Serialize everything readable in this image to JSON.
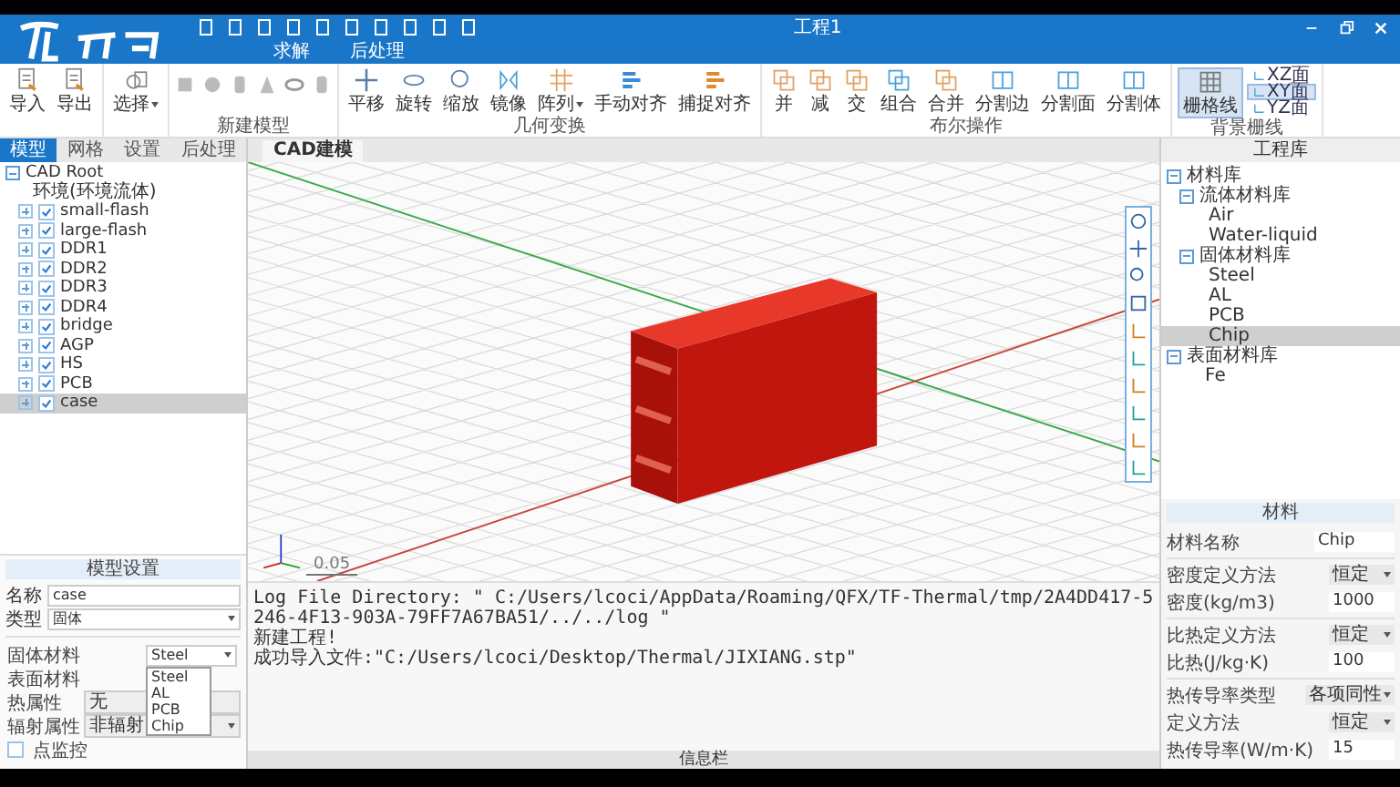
{
  "window": {
    "title": "工程1"
  },
  "ribbon_tabs": [
    "求解",
    "后处理"
  ],
  "ribbon": {
    "file_buttons": [
      "导入",
      "导出"
    ],
    "select_button": {
      "label": "选择",
      "dropdown": true
    },
    "new_model_label": "新建模型",
    "transform": {
      "label": "几何变换",
      "buttons": [
        {
          "label": "平移",
          "dropdown": false
        },
        {
          "label": "旋转",
          "dropdown": false
        },
        {
          "label": "缩放",
          "dropdown": false
        },
        {
          "label": "镜像",
          "dropdown": false
        },
        {
          "label": "阵列",
          "dropdown": true
        },
        {
          "label": "手动对齐",
          "dropdown": false
        },
        {
          "label": "捕捉对齐",
          "dropdown": false
        }
      ]
    },
    "boolean": {
      "label": "布尔操作",
      "buttons": [
        "并",
        "减",
        "交",
        "组合",
        "合并",
        "分割边",
        "分割面",
        "分割体"
      ]
    },
    "background_grid": {
      "label": "背景栅线",
      "grid_button": {
        "label": "栅格线",
        "selected": true
      },
      "planes": [
        {
          "label": "XZ面",
          "selected": false
        },
        {
          "label": "XY面",
          "selected": true
        },
        {
          "label": "YZ面",
          "selected": false
        }
      ]
    }
  },
  "left_panel": {
    "tabs": [
      {
        "label": "模型",
        "selected": true
      },
      {
        "label": "网格",
        "selected": false
      },
      {
        "label": "设置",
        "selected": false
      },
      {
        "label": "后处理",
        "selected": false
      }
    ],
    "tree": {
      "label": "CAD Root",
      "expanded": true,
      "children": [
        {
          "kind": "environment",
          "label": "环境(环境流体)"
        },
        {
          "kind": "part",
          "label": "small-flash",
          "expanded": false,
          "checked": true,
          "selected": false
        },
        {
          "kind": "part",
          "label": "large-flash",
          "expanded": false,
          "checked": true,
          "selected": false
        },
        {
          "kind": "part",
          "label": "DDR1",
          "expanded": false,
          "checked": true,
          "selected": false
        },
        {
          "kind": "part",
          "label": "DDR2",
          "expanded": false,
          "checked": true,
          "selected": false
        },
        {
          "kind": "part",
          "label": "DDR3",
          "expanded": false,
          "checked": true,
          "selected": false
        },
        {
          "kind": "part",
          "label": "DDR4",
          "expanded": false,
          "checked": true,
          "selected": false
        },
        {
          "kind": "part",
          "label": "bridge",
          "expanded": false,
          "checked": true,
          "selected": false
        },
        {
          "kind": "part",
          "label": "AGP",
          "expanded": false,
          "checked": true,
          "selected": false
        },
        {
          "kind": "part",
          "label": "HS",
          "expanded": false,
          "checked": true,
          "selected": false
        },
        {
          "kind": "part",
          "label": "PCB",
          "expanded": false,
          "checked": true,
          "selected": false
        },
        {
          "kind": "part",
          "label": "case",
          "expanded": false,
          "checked": true,
          "selected": true
        }
      ]
    }
  },
  "model_settings": {
    "title": "模型设置",
    "name": {
      "label": "名称",
      "value": "case"
    },
    "type": {
      "label": "类型",
      "value": "固体"
    },
    "solid_material": {
      "label": "固体材料",
      "value": "Steel",
      "options": [
        "Steel",
        "AL",
        "PCB",
        "Chip"
      ]
    },
    "surface_material": {
      "label": "表面材料"
    },
    "thermal": {
      "label": "热属性",
      "value": "无"
    },
    "radiation": {
      "label": "辐射属性",
      "value": "非辐射"
    },
    "point_monitor": {
      "label": "点监控",
      "checked": false
    }
  },
  "viewport": {
    "tab": "CAD建模",
    "scale_label": "0.05"
  },
  "log": {
    "lines": [
      "Log File Directory: \" C:/Users/lcoci/AppData/Roaming/QFX/TF-Thermal/tmp/2A4DD417-5246-4F13-903A-79FF7A67BA51/../../log \"",
      "新建工程!",
      "成功导入文件:\"C:/Users/lcoci/Desktop/Thermal/JIXIANG.stp\""
    ]
  },
  "status_bar": {
    "label": "信息栏"
  },
  "right_panel": {
    "title": "工程库",
    "tree": [
      {
        "label": "材料库",
        "expanded": true,
        "children": [
          {
            "label": "流体材料库",
            "expanded": true,
            "children": [
              {
                "label": "Air",
                "selected": false
              },
              {
                "label": "Water-liquid",
                "selected": false
              }
            ]
          },
          {
            "label": "固体材料库",
            "expanded": true,
            "children": [
              {
                "label": "Steel",
                "selected": false
              },
              {
                "label": "AL",
                "selected": false
              },
              {
                "label": "PCB",
                "selected": false
              },
              {
                "label": "Chip",
                "selected": true
              }
            ]
          }
        ]
      },
      {
        "label": "表面材料库",
        "expanded": true,
        "children": [
          {
            "label": "Fe",
            "selected": false
          }
        ]
      }
    ]
  },
  "material": {
    "title": "材料",
    "groups": [
      [
        {
          "kind": "text",
          "label": "材料名称",
          "value": "Chip"
        }
      ],
      [
        {
          "kind": "select",
          "label": "密度定义方法",
          "value": "恒定"
        },
        {
          "kind": "input",
          "label": "密度(kg/m3)",
          "value": "1000"
        }
      ],
      [
        {
          "kind": "select",
          "label": "比热定义方法",
          "value": "恒定"
        },
        {
          "kind": "input",
          "label": "比热(J/kg·K)",
          "value": "100"
        }
      ],
      [
        {
          "kind": "select",
          "label": "热传导率类型",
          "value": "各项同性"
        },
        {
          "kind": "select",
          "label": "定义方法",
          "value": "恒定"
        },
        {
          "kind": "input",
          "label": "热传导率(W/m·K)",
          "value": "15"
        }
      ]
    ]
  }
}
